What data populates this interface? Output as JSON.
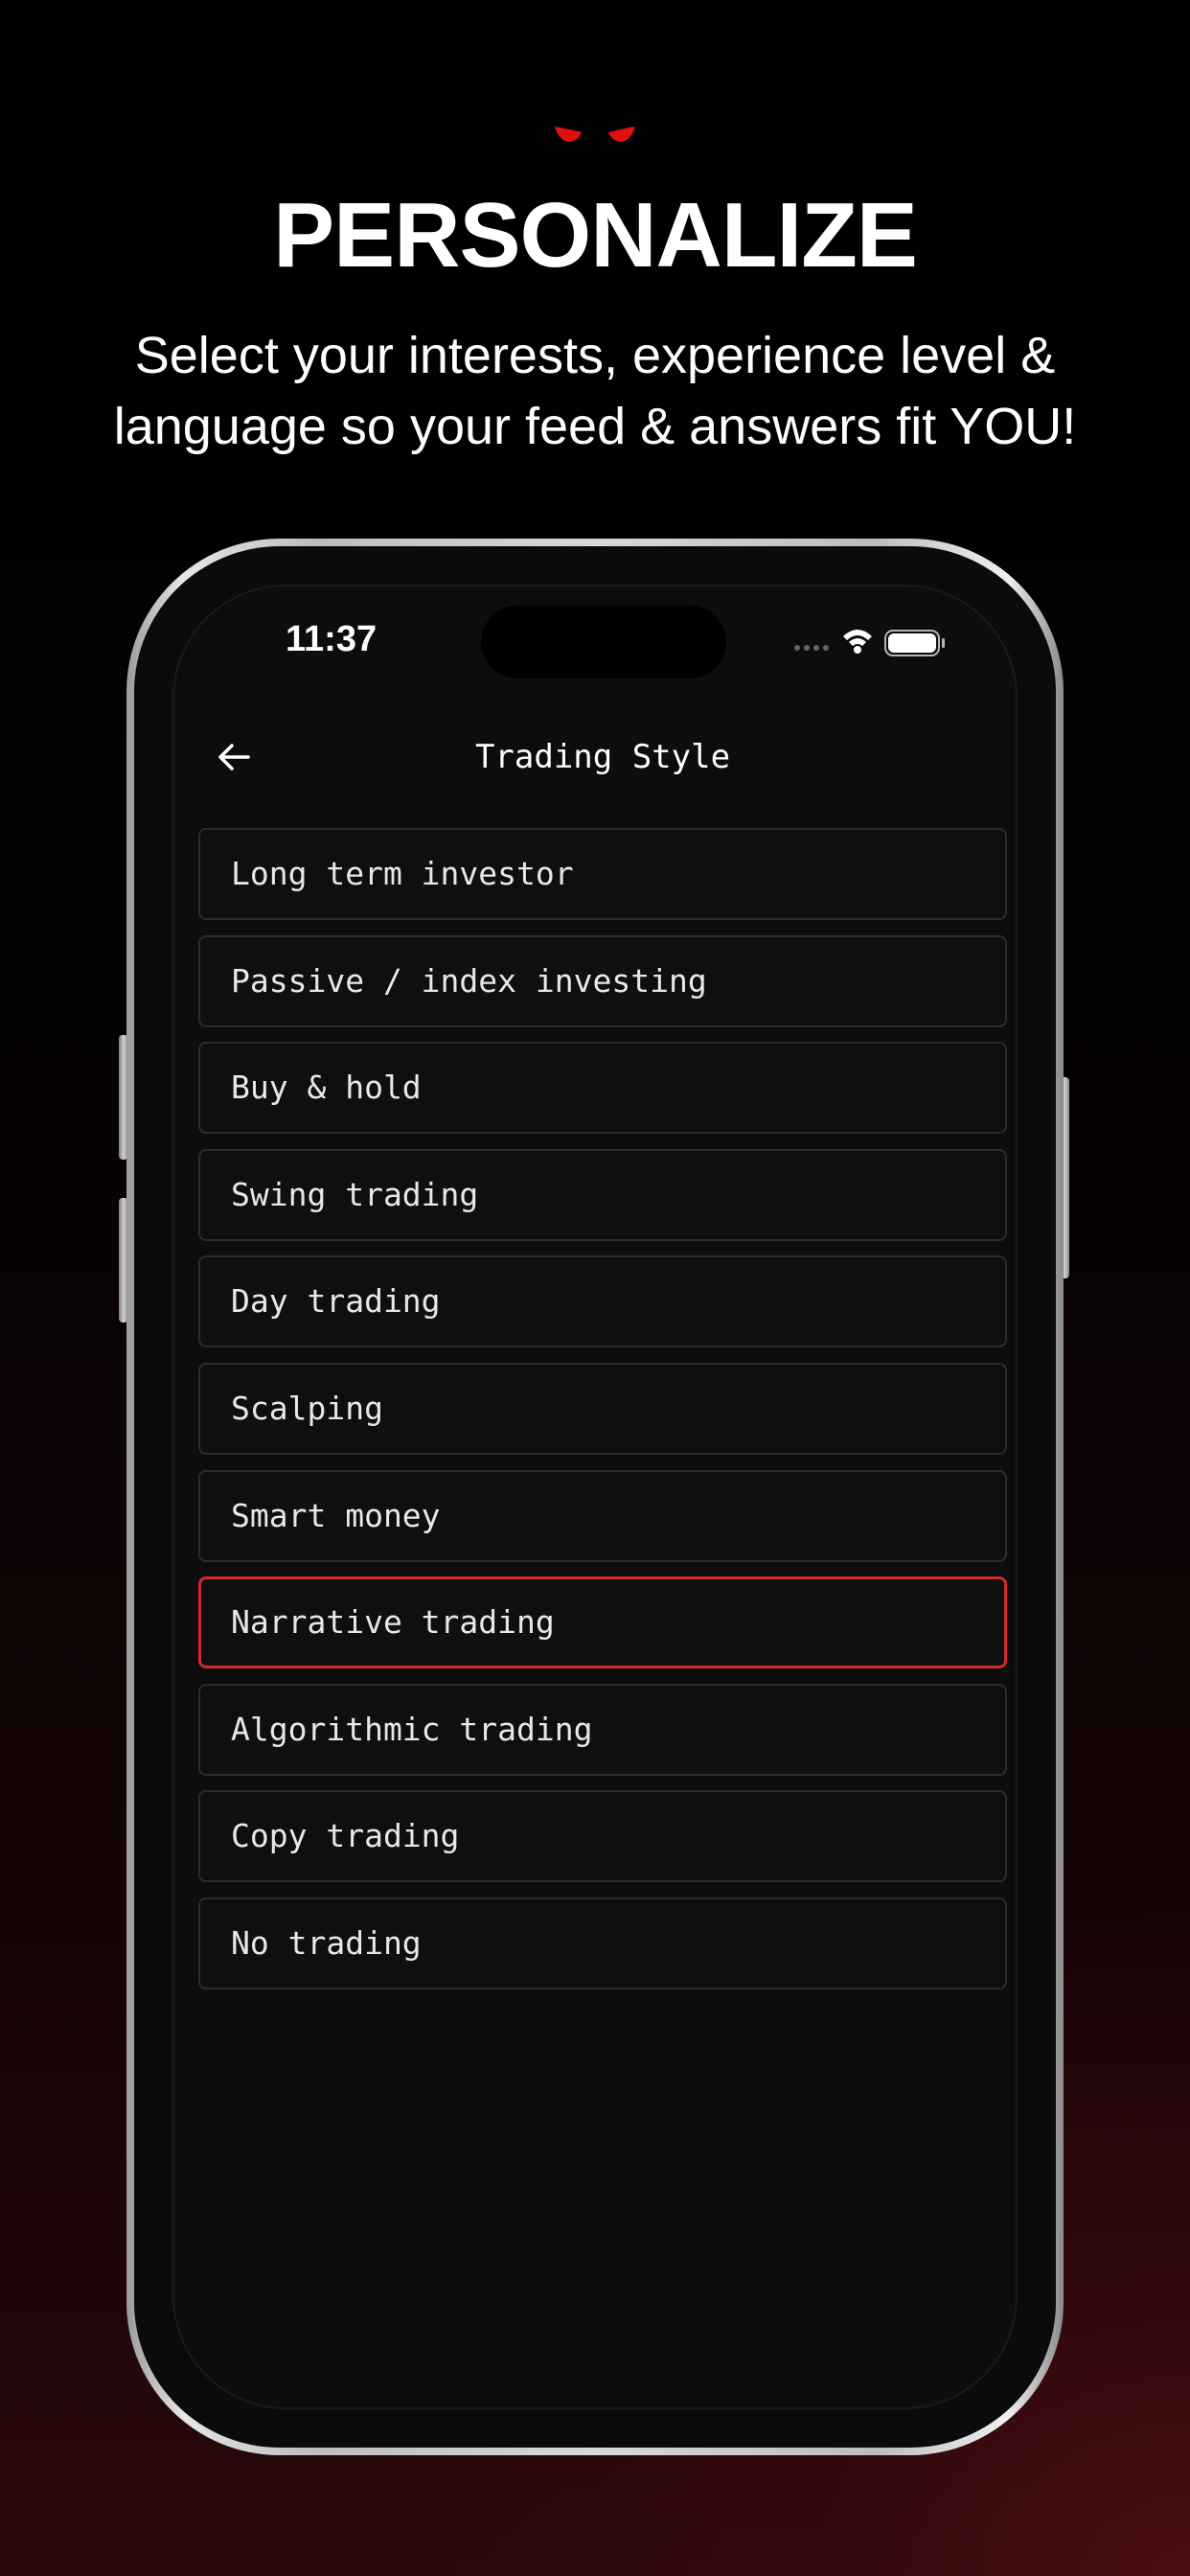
{
  "header": {
    "title": "PERSONALIZE",
    "subtitle": "Select your interests, experience level & language so your feed & answers fit YOU!"
  },
  "status_bar": {
    "time": "11:37"
  },
  "screen": {
    "title": "Trading Style",
    "options": [
      {
        "label": "Long term investor",
        "selected": false
      },
      {
        "label": "Passive / index investing",
        "selected": false
      },
      {
        "label": "Buy & hold",
        "selected": false
      },
      {
        "label": "Swing trading",
        "selected": false
      },
      {
        "label": "Day trading",
        "selected": false
      },
      {
        "label": "Scalping",
        "selected": false
      },
      {
        "label": "Smart money",
        "selected": false
      },
      {
        "label": "Narrative trading",
        "selected": true
      },
      {
        "label": "Algorithmic trading",
        "selected": false
      },
      {
        "label": "Copy trading",
        "selected": false
      },
      {
        "label": "No trading",
        "selected": false
      }
    ]
  },
  "icons": {
    "logo": "eyes-logo-icon",
    "back": "arrow-left-icon",
    "signal": "cellular-signal-icon",
    "wifi": "wifi-icon",
    "battery": "battery-icon"
  },
  "colors": {
    "accent": "#d02a2a",
    "logo_red": "#e01010",
    "option_border": "#2c2c2c",
    "screen_bg": "#0d0d0d"
  }
}
